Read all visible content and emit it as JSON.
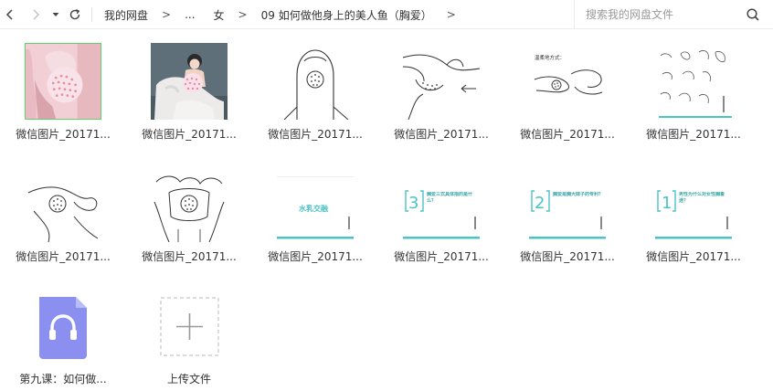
{
  "toolbar": {
    "back_icon": "chevron-left-icon",
    "forward_icon": "chevron-right-icon",
    "dropdown_icon": "caret-down-icon",
    "refresh_icon": "refresh-icon"
  },
  "breadcrumb": {
    "items": [
      "我的网盘",
      "...",
      "女",
      "09 如何做他身上的美人鱼（胸爱）"
    ],
    "separator": ">"
  },
  "search": {
    "placeholder": "搜索我的网盘文件",
    "icon": "search-icon"
  },
  "files": [
    {
      "name": "微信图片_20171...",
      "kind": "image",
      "thumb": "pink-photo"
    },
    {
      "name": "微信图片_20171...",
      "kind": "image",
      "thumb": "woman-illustration"
    },
    {
      "name": "微信图片_20171...",
      "kind": "image",
      "thumb": "line-sketch-1"
    },
    {
      "name": "微信图片_20171...",
      "kind": "image",
      "thumb": "line-sketch-2"
    },
    {
      "name": "微信图片_20171...",
      "kind": "image",
      "thumb": "line-sketch-3",
      "caption": "温柔地方式："
    },
    {
      "name": "微信图片_20171...",
      "kind": "image",
      "thumb": "small-sketches"
    },
    {
      "name": "微信图片_20171...",
      "kind": "image",
      "thumb": "line-sketch-4"
    },
    {
      "name": "微信图片_20171...",
      "kind": "image",
      "thumb": "line-sketch-5"
    },
    {
      "name": "微信图片_20171...",
      "kind": "image",
      "thumb": "title-card",
      "caption": "水乳交融"
    },
    {
      "name": "微信图片_20171...",
      "kind": "image",
      "thumb": "numbered-card",
      "number": "3",
      "caption": "胸爱三式具体指的是什么？"
    },
    {
      "name": "微信图片_20171...",
      "kind": "image",
      "thumb": "numbered-card",
      "number": "2",
      "caption": "胸爱是胸大妹子的专利？"
    },
    {
      "name": "微信图片_20171...",
      "kind": "image",
      "thumb": "numbered-card",
      "number": "1",
      "caption": "男性为什么对女性胸着迷？"
    },
    {
      "name": "第九课：如何做...",
      "kind": "audio",
      "thumb": "headphones-icon"
    },
    {
      "name": "上传文件",
      "kind": "upload",
      "thumb": "plus-icon"
    }
  ],
  "colors": {
    "teal": "#4cc3c4",
    "audio_tile": "#8a8ff0",
    "pink": "#f2cfd4",
    "selected_border": "#5ed36a"
  }
}
